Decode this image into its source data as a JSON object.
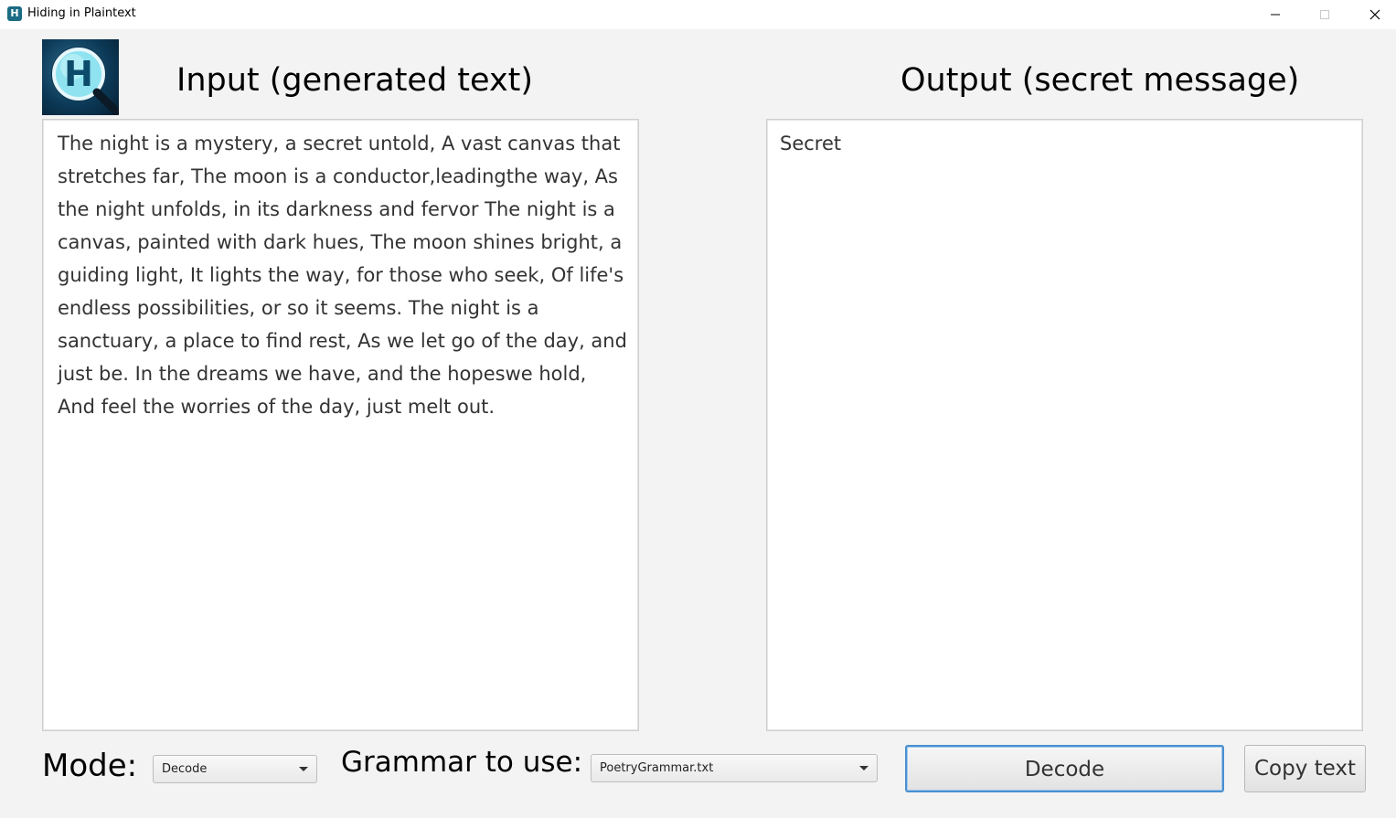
{
  "window": {
    "title": "Hiding in Plaintext",
    "app_icon_letter": "H"
  },
  "logo": {
    "letter": "H",
    "colors": {
      "background": "#0c3a58",
      "lens": "#8fe3f0",
      "letter": "#0d4b6b"
    }
  },
  "input_panel": {
    "heading": "Input (generated text)",
    "text": "The night is a mystery, a secret untold, A vast canvas that stretches far, The moon is a conductor,leadingthe way, As the night unfolds, in its darkness and fervor The night is a canvas, painted with dark hues, The moon shines bright, a guiding light, It lights the way, for those who seek, Of life's endless possibilities, or so it seems. The night is a sanctuary, a place to find rest, As we let go of the day, and just be. In the dreams we have, and the hopeswe hold, And feel the worries of the day, just melt out."
  },
  "output_panel": {
    "heading": "Output (secret message)",
    "text": "Secret"
  },
  "controls": {
    "mode_label": "Mode:",
    "mode_value": "Decode",
    "grammar_label": "Grammar to use:",
    "grammar_value": "PoetryGrammar.txt",
    "decode_button": "Decode",
    "copy_button": "Copy text"
  },
  "icons": {
    "minimize": "minimize-icon",
    "maximize": "maximize-icon",
    "close": "close-icon",
    "dropdown": "chevron-down-icon"
  },
  "colors": {
    "window_background": "#f3f3f3",
    "focus_border": "#4a90d0"
  }
}
